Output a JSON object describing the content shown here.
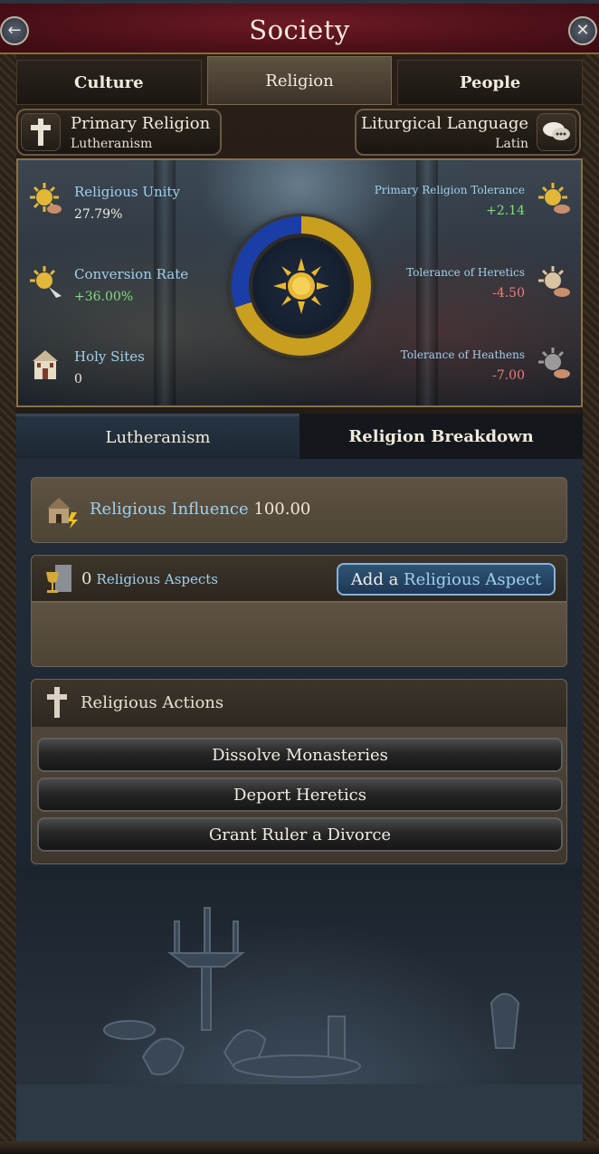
{
  "header": {
    "title": "Society"
  },
  "tabs": [
    {
      "label": "Culture",
      "active": false
    },
    {
      "label": "Religion",
      "active": true
    },
    {
      "label": "People",
      "active": false
    }
  ],
  "primary_religion": {
    "label": "Primary Religion",
    "value": "Lutheranism"
  },
  "liturgical_language": {
    "label": "Liturgical Language",
    "value": "Latin"
  },
  "stats": {
    "religious_unity": {
      "label": "Religious Unity",
      "value": "27.79%"
    },
    "conversion_rate": {
      "label": "Conversion Rate",
      "value": "+36.00%"
    },
    "holy_sites": {
      "label": "Holy Sites",
      "value": "0"
    },
    "primary_tolerance": {
      "label": "Primary Religion Tolerance",
      "value": "+2.14"
    },
    "tolerance_heretics": {
      "label": "Tolerance of Heretics",
      "value": "-4.50"
    },
    "tolerance_heathens": {
      "label": "Tolerance of Heathens",
      "value": "-7.00"
    }
  },
  "unity_dial": {
    "fraction": 0.7,
    "colors": {
      "gold": "#c99f1f",
      "blue": "#1a3ea6"
    }
  },
  "subtabs": [
    {
      "label": "Lutheranism",
      "active": true
    },
    {
      "label": "Religion Breakdown",
      "active": false
    }
  ],
  "influence": {
    "label": "Religious Influence",
    "value": "100.00"
  },
  "aspects": {
    "count": "0",
    "label": "Religious Aspects",
    "add_prefix": "Add a",
    "add_highlight": "Religious Aspect"
  },
  "actions": {
    "title": "Religious Actions",
    "items": [
      "Dissolve Monasteries",
      "Deport Heretics",
      "Grant Ruler a Divorce"
    ]
  },
  "icons": {
    "back": "back-arrow-icon",
    "close": "close-icon",
    "cross": "cross-icon",
    "speech": "speech-bubble-icon",
    "sun": "sun-icon",
    "church": "church-icon",
    "chalice": "chalice-icon"
  }
}
